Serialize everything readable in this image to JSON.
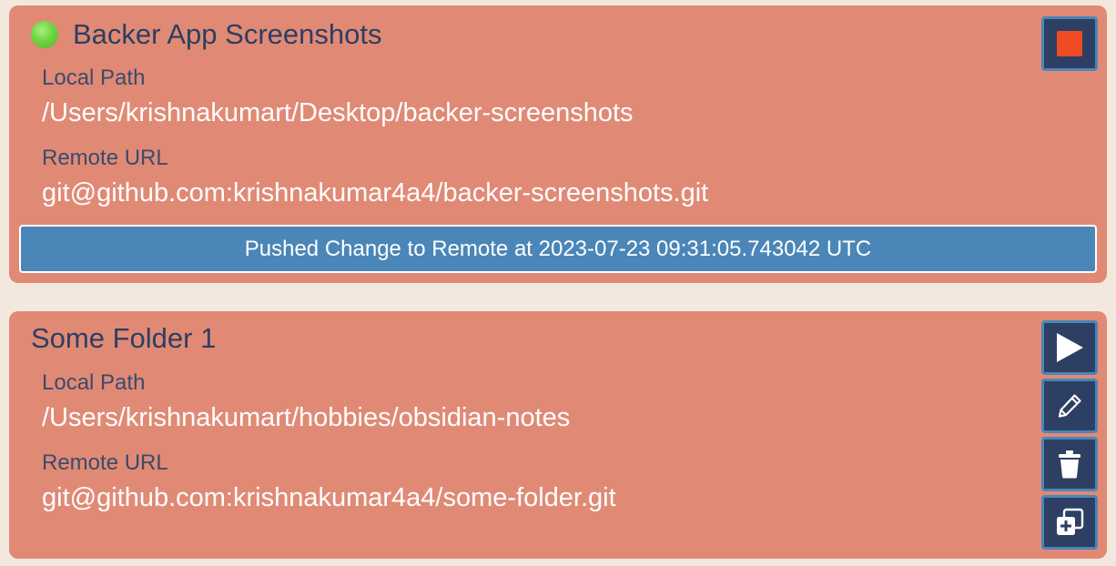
{
  "folders": [
    {
      "title": "Backer App Screenshots",
      "status_color": "#6ed542",
      "local_path_label": "Local Path",
      "local_path": "/Users/krishnakumart/Desktop/backer-screenshots",
      "remote_url_label": "Remote URL",
      "remote_url": "git@github.com:krishnakumar4a4/backer-screenshots.git",
      "status_message": "Pushed Change to Remote at 2023-07-23 09:31:05.743042 UTC",
      "actions": [
        "stop-icon"
      ]
    },
    {
      "title": "Some Folder 1",
      "local_path_label": "Local Path",
      "local_path": "/Users/krishnakumart/hobbies/obsidian-notes",
      "remote_url_label": "Remote URL",
      "remote_url": "git@github.com:krishnakumar4a4/some-folder.git",
      "actions": [
        "play-icon",
        "pencil-icon",
        "trash-icon",
        "duplicate-icon"
      ]
    }
  ],
  "colors": {
    "background": "#f3e8dd",
    "card": "#e08a75",
    "title_text": "#2c3e63",
    "label_text": "#3a4b6e",
    "status_bar": "#4a86b8",
    "button_bg": "#2d3f62",
    "button_border": "#4a86b8",
    "stop_red": "#ef4b25"
  }
}
